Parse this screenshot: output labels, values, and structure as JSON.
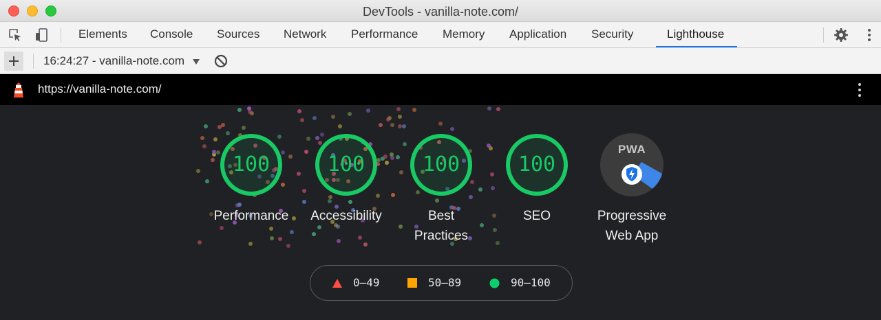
{
  "window": {
    "title": "DevTools - vanilla-note.com/"
  },
  "tabs": [
    {
      "label": "Elements"
    },
    {
      "label": "Console"
    },
    {
      "label": "Sources"
    },
    {
      "label": "Network"
    },
    {
      "label": "Performance"
    },
    {
      "label": "Memory"
    },
    {
      "label": "Application"
    },
    {
      "label": "Security"
    },
    {
      "label": "Lighthouse"
    }
  ],
  "active_tab": "Lighthouse",
  "toolbar": {
    "report_select": "16:24:27 - vanilla-note.com"
  },
  "urlbar": {
    "url": "https://vanilla-note.com/"
  },
  "scores": [
    {
      "value": "100",
      "label": "Performance"
    },
    {
      "value": "100",
      "label": "Accessibility"
    },
    {
      "value": "100",
      "label_line1": "Best",
      "label_line2": "Practices"
    },
    {
      "value": "100",
      "label": "SEO"
    }
  ],
  "pwa": {
    "badge": "PWA",
    "label_line1": "Progressive",
    "label_line2": "Web App"
  },
  "legend": [
    {
      "range": "0–49",
      "shape": "triangle",
      "color": "#ff4e42"
    },
    {
      "range": "50–89",
      "shape": "square",
      "color": "#ffa400"
    },
    {
      "range": "90–100",
      "shape": "circle",
      "color": "#0cce6b"
    }
  ],
  "colors": {
    "pass": "#18c964",
    "accent": "#1a73e8"
  }
}
